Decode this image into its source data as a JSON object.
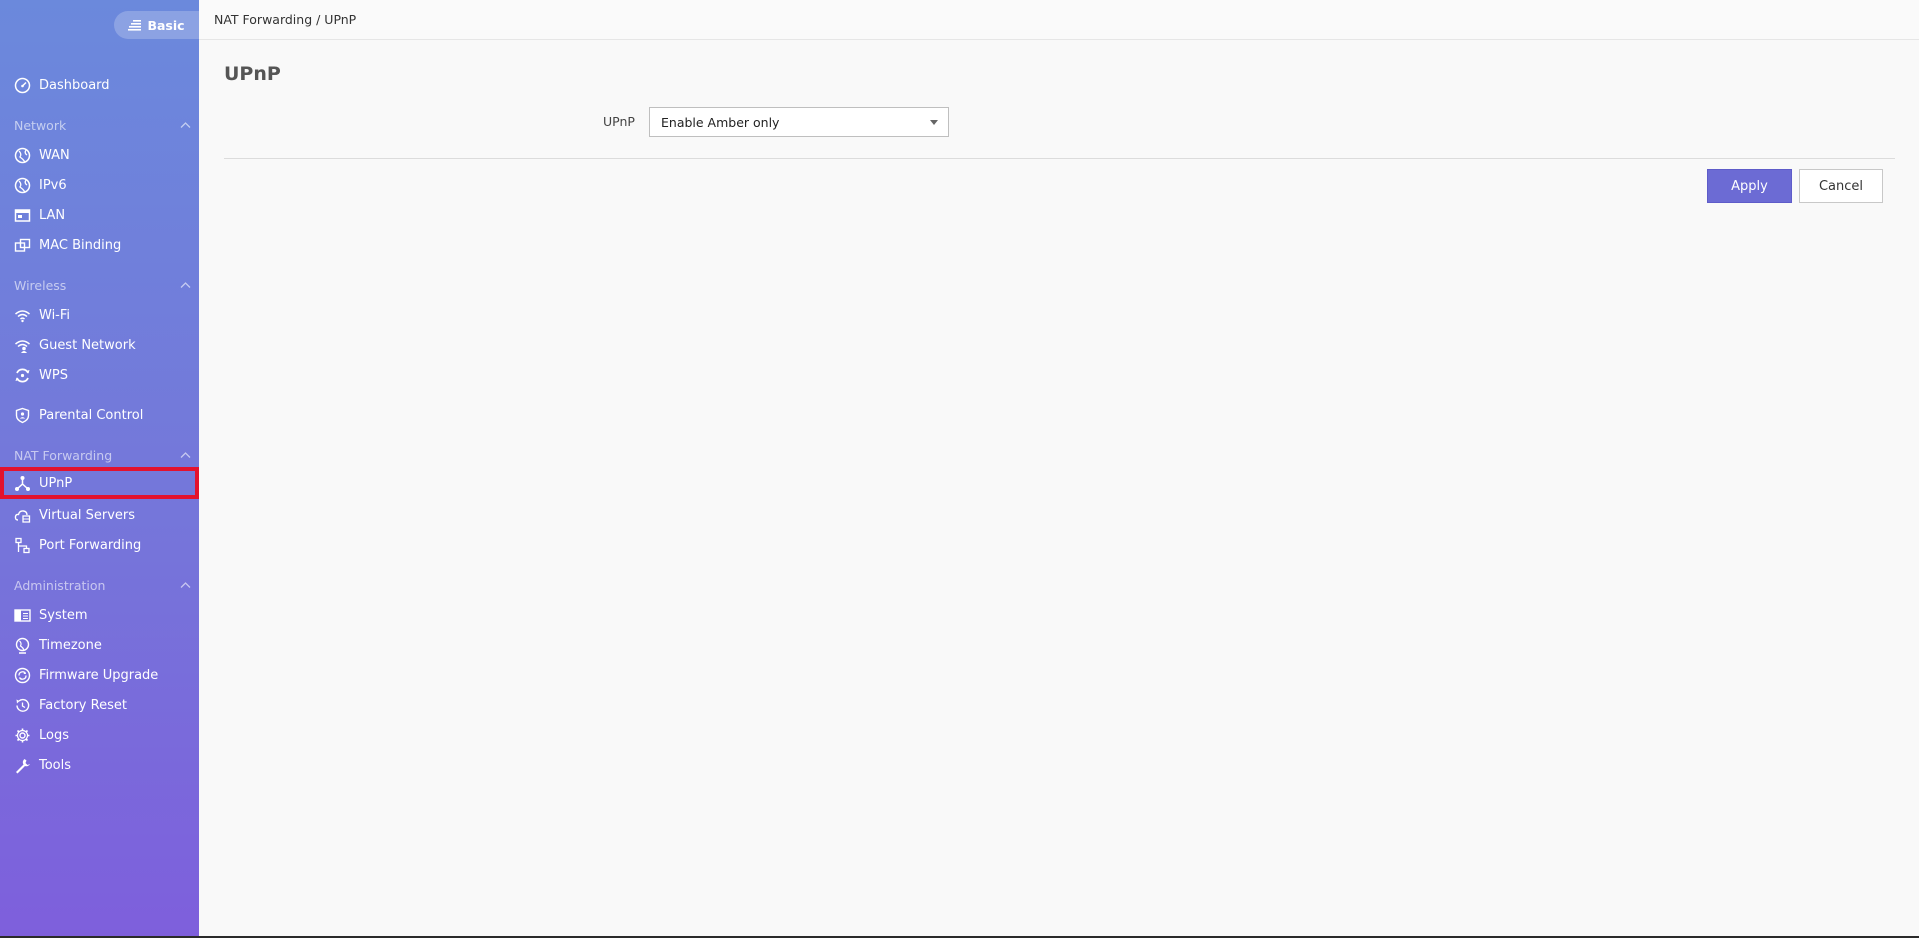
{
  "mode_toggle": {
    "label": "Basic"
  },
  "breadcrumb": {
    "text": "NAT Forwarding / UPnP"
  },
  "sidebar": {
    "dashboard": "Dashboard",
    "sections": {
      "network": "Network",
      "wireless": "Wireless",
      "nat": "NAT Forwarding",
      "admin": "Administration"
    },
    "items": {
      "wan": "WAN",
      "ipv6": "IPv6",
      "lan": "LAN",
      "mac_binding": "MAC Binding",
      "wifi": "Wi-Fi",
      "guest_network": "Guest Network",
      "wps": "WPS",
      "parental_control": "Parental Control",
      "upnp": "UPnP",
      "virtual_servers": "Virtual Servers",
      "port_forwarding": "Port Forwarding",
      "system": "System",
      "timezone": "Timezone",
      "firmware_upgrade": "Firmware Upgrade",
      "factory_reset": "Factory Reset",
      "logs": "Logs",
      "tools": "Tools"
    }
  },
  "main": {
    "title": "UPnP",
    "upnp_label": "UPnP",
    "upnp_value": "Enable Amber only",
    "apply_label": "Apply",
    "cancel_label": "Cancel"
  },
  "colors": {
    "sidebar_top": "#6b89dc",
    "sidebar_bottom": "#7e5fdc",
    "apply_button": "#6c6bd4",
    "active_highlight": "#e3122e"
  }
}
